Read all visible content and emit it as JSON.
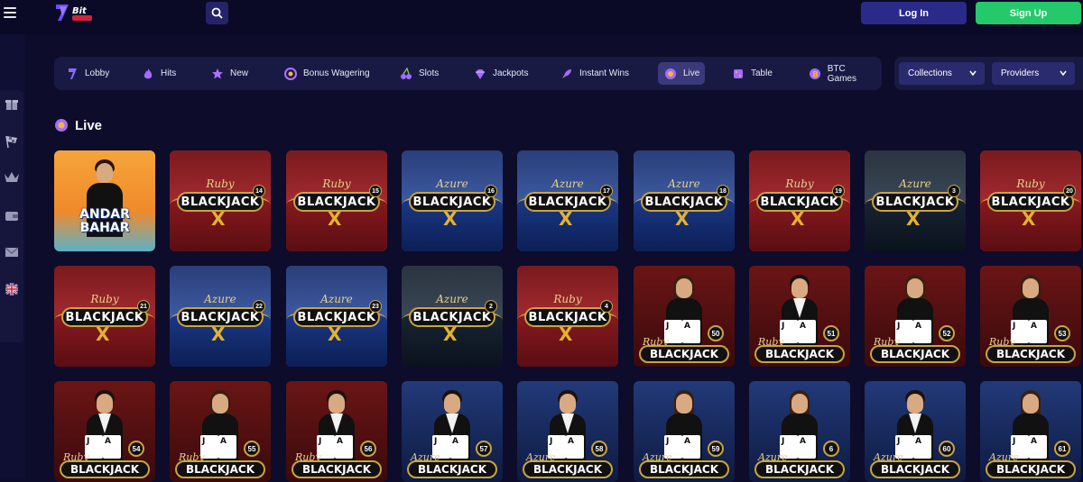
{
  "header": {
    "logo_text": "Bit",
    "login_label": "Log In",
    "signup_label": "Sign Up",
    "accent": "#23c96a"
  },
  "nav": {
    "items": [
      {
        "label": "Lobby",
        "icon": "lobby-icon"
      },
      {
        "label": "Hits",
        "icon": "flame-icon"
      },
      {
        "label": "New",
        "icon": "star-icon"
      },
      {
        "label": "Bonus Wagering",
        "icon": "target-icon"
      },
      {
        "label": "Slots",
        "icon": "cherries-icon"
      },
      {
        "label": "Jackpots",
        "icon": "gem-icon"
      },
      {
        "label": "Instant Wins",
        "icon": "rocket-icon"
      },
      {
        "label": "Live",
        "icon": "chip-icon",
        "active": true
      },
      {
        "label": "Table",
        "icon": "dice-icon"
      },
      {
        "label": "BTC Games",
        "icon": "bitcoin-icon"
      }
    ],
    "collections_label": "Collections",
    "providers_label": "Providers"
  },
  "sidebar": {
    "icons": [
      "gift-icon",
      "racing-flag-icon",
      "crown-icon",
      "wallet-icon",
      "mail-icon",
      "uk-flag-icon"
    ]
  },
  "section": {
    "title": "Live"
  },
  "games": {
    "row1": [
      {
        "type": "andar",
        "line1": "ANDAR",
        "line2": "BAHAR"
      },
      {
        "type": "x",
        "theme": "ruby",
        "brand": "Ruby",
        "name": "BLACKJACK",
        "mark": "X",
        "num": "14"
      },
      {
        "type": "x",
        "theme": "ruby",
        "brand": "Ruby",
        "name": "BLACKJACK",
        "mark": "X",
        "num": "15"
      },
      {
        "type": "x",
        "theme": "azure",
        "brand": "Azure",
        "name": "BLACKJACK",
        "mark": "X",
        "num": "16"
      },
      {
        "type": "x",
        "theme": "azure",
        "brand": "Azure",
        "name": "BLACKJACK",
        "mark": "X",
        "num": "17"
      },
      {
        "type": "x",
        "theme": "azure",
        "brand": "Azure",
        "name": "BLACKJACK",
        "mark": "X",
        "num": "18"
      },
      {
        "type": "x",
        "theme": "ruby",
        "brand": "Ruby",
        "name": "BLACKJACK",
        "mark": "X",
        "num": "19"
      },
      {
        "type": "x",
        "theme": "dark",
        "brand": "Azure",
        "name": "BLACKJACK",
        "mark": "X",
        "num": "3"
      },
      {
        "type": "x",
        "theme": "ruby",
        "brand": "Ruby",
        "name": "BLACKJACK",
        "mark": "X",
        "num": "20"
      }
    ],
    "row2": [
      {
        "type": "x",
        "theme": "ruby",
        "brand": "Ruby",
        "name": "BLACKJACK",
        "mark": "X",
        "num": "21"
      },
      {
        "type": "x",
        "theme": "azure",
        "brand": "Azure",
        "name": "BLACKJACK",
        "mark": "X",
        "num": "22"
      },
      {
        "type": "x",
        "theme": "azure",
        "brand": "Azure",
        "name": "BLACKJACK",
        "mark": "X",
        "num": "23"
      },
      {
        "type": "x",
        "theme": "dark",
        "brand": "Azure",
        "name": "BLACKJACK",
        "mark": "X",
        "num": "2"
      },
      {
        "type": "x",
        "theme": "ruby",
        "brand": "Ruby",
        "name": "BLACKJACK",
        "mark": "X",
        "num": "4"
      },
      {
        "type": "live",
        "theme": "ruby",
        "brand": "Ruby",
        "name": "BLACKJACK",
        "num": "50",
        "dealer": "f"
      },
      {
        "type": "live",
        "theme": "ruby",
        "brand": "Ruby",
        "name": "BLACKJACK",
        "num": "51",
        "dealer": "m"
      },
      {
        "type": "live",
        "theme": "ruby",
        "brand": "Ruby",
        "name": "BLACKJACK",
        "num": "52",
        "dealer": "f"
      },
      {
        "type": "live",
        "theme": "ruby",
        "brand": "Ruby",
        "name": "BLACKJACK",
        "num": "53",
        "dealer": "f"
      }
    ],
    "row3": [
      {
        "type": "live",
        "theme": "ruby",
        "brand": "Ruby",
        "name": "BLACKJACK",
        "num": "54",
        "dealer": "m"
      },
      {
        "type": "live",
        "theme": "ruby",
        "brand": "Ruby",
        "name": "BLACKJACK",
        "num": "55",
        "dealer": "f"
      },
      {
        "type": "live",
        "theme": "ruby",
        "brand": "Ruby",
        "name": "BLACKJACK",
        "num": "56",
        "dealer": "m"
      },
      {
        "type": "live",
        "theme": "azure",
        "brand": "Azure",
        "name": "BLACKJACK",
        "num": "57",
        "dealer": "m"
      },
      {
        "type": "live",
        "theme": "azure",
        "brand": "Azure",
        "name": "BLACKJACK",
        "num": "58",
        "dealer": "m"
      },
      {
        "type": "live",
        "theme": "azure",
        "brand": "Azure",
        "name": "BLACKJACK",
        "num": "59",
        "dealer": "f"
      },
      {
        "type": "live",
        "theme": "azure",
        "brand": "Azure",
        "name": "BLACKJACK",
        "num": "6",
        "dealer": "f"
      },
      {
        "type": "live",
        "theme": "azure",
        "brand": "Azure",
        "name": "BLACKJACK",
        "num": "60",
        "dealer": "m"
      },
      {
        "type": "live",
        "theme": "azure",
        "brand": "Azure",
        "name": "BLACKJACK",
        "num": "61",
        "dealer": "f"
      }
    ]
  }
}
